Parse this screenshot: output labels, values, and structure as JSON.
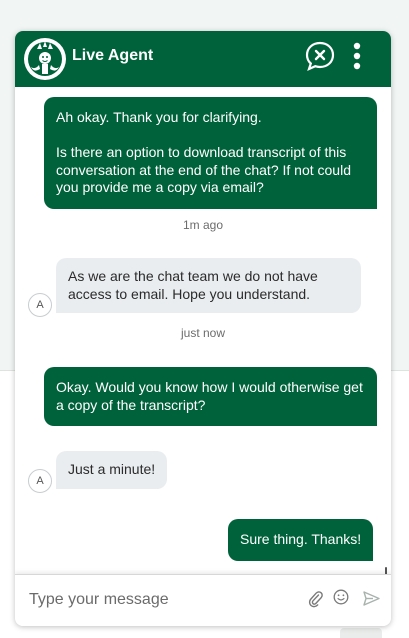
{
  "header": {
    "title": "Live Agent",
    "logo_icon": "starbucks-siren-logo",
    "end_chat_icon": "end-chat-icon",
    "menu_icon": "more-vertical-icon",
    "brand_color": "#00623b"
  },
  "messages": [
    {
      "from": "user",
      "text": "Ah okay. Thank you for clarifying.\n\nIs there an option to download transcript of this conversation at the end of the chat? If not could you provide me a copy via email?"
    },
    {
      "timestamp": "1m ago"
    },
    {
      "from": "agent",
      "avatar": "A",
      "text": "As we are the chat team we do not have access to email. Hope you understand."
    },
    {
      "timestamp": "just now"
    },
    {
      "from": "user",
      "text": "Okay. Would you know how I would otherwise get a copy of the transcript?"
    },
    {
      "from": "agent",
      "avatar": "A",
      "text": "Just a minute!"
    },
    {
      "from": "user",
      "text": "Sure thing. Thanks!"
    }
  ],
  "composer": {
    "placeholder": "Type your message",
    "attach_icon": "paperclip-icon",
    "emoji_icon": "smiley-icon",
    "send_icon": "send-icon"
  }
}
